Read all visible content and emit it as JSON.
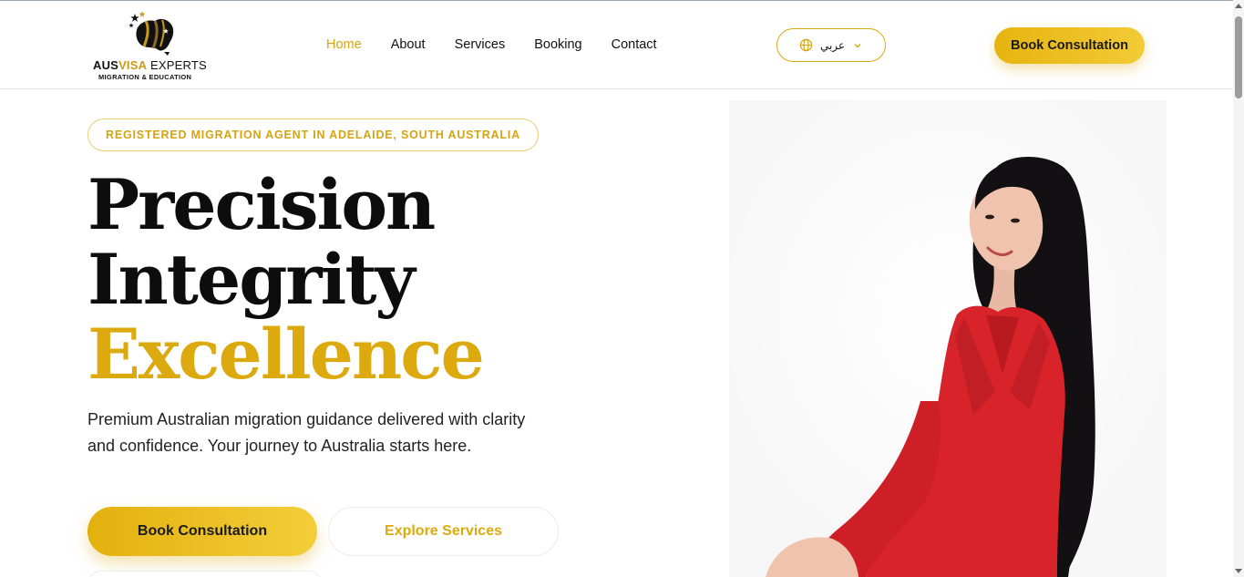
{
  "brand": {
    "name_part1": "AUS",
    "name_part2": "VISA",
    "name_part3": " EXPERTS",
    "tagline": "MIGRATION & EDUCATION"
  },
  "nav": {
    "items": [
      {
        "label": "Home",
        "active": true
      },
      {
        "label": "About"
      },
      {
        "label": "Services"
      },
      {
        "label": "Booking"
      },
      {
        "label": "Contact"
      }
    ]
  },
  "language": {
    "label": "عربي",
    "icon": "globe-icon"
  },
  "header": {
    "cta_label": "Book Consultation"
  },
  "hero": {
    "badge": "REGISTERED MIGRATION AGENT IN ADELAIDE, SOUTH AUSTRALIA",
    "headline_line1": "Precision",
    "headline_line2": "Integrity",
    "headline_line3": "Excellence",
    "lead": "Premium Australian migration guidance delivered with clarity and confidence. Your journey to Australia starts here.",
    "primary_cta": "Book Consultation",
    "secondary_cta": "Explore Services"
  },
  "colors": {
    "accent": "#dcaa0f",
    "text": "#0d0d0d",
    "jacket": "#d8232a"
  }
}
